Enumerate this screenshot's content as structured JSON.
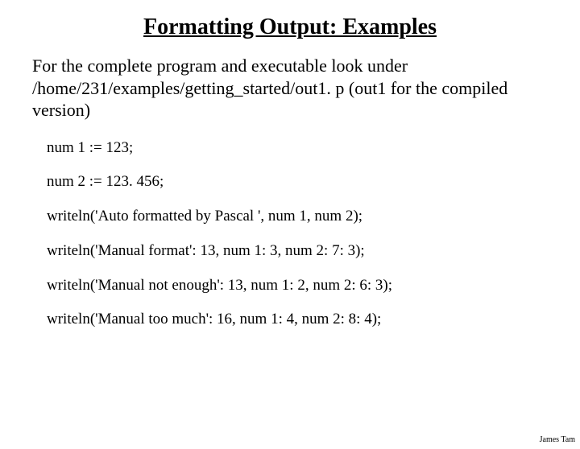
{
  "title": "Formatting Output: Examples",
  "intro": "For the complete program and executable look under /home/231/examples/getting_started/out1. p (out1 for the compiled version)",
  "code": {
    "l1": "num 1 := 123;",
    "l2": "num 2 := 123. 456;",
    "l3": "writeln('Auto formatted by Pascal ', num 1, num 2);",
    "l4": "writeln('Manual format': 13, num 1: 3, num 2: 7: 3);",
    "l5": "writeln('Manual not enough': 13, num 1: 2, num 2: 6: 3);",
    "l6": "writeln('Manual too much': 16, num 1: 4, num 2: 8: 4);"
  },
  "footer": "James Tam"
}
